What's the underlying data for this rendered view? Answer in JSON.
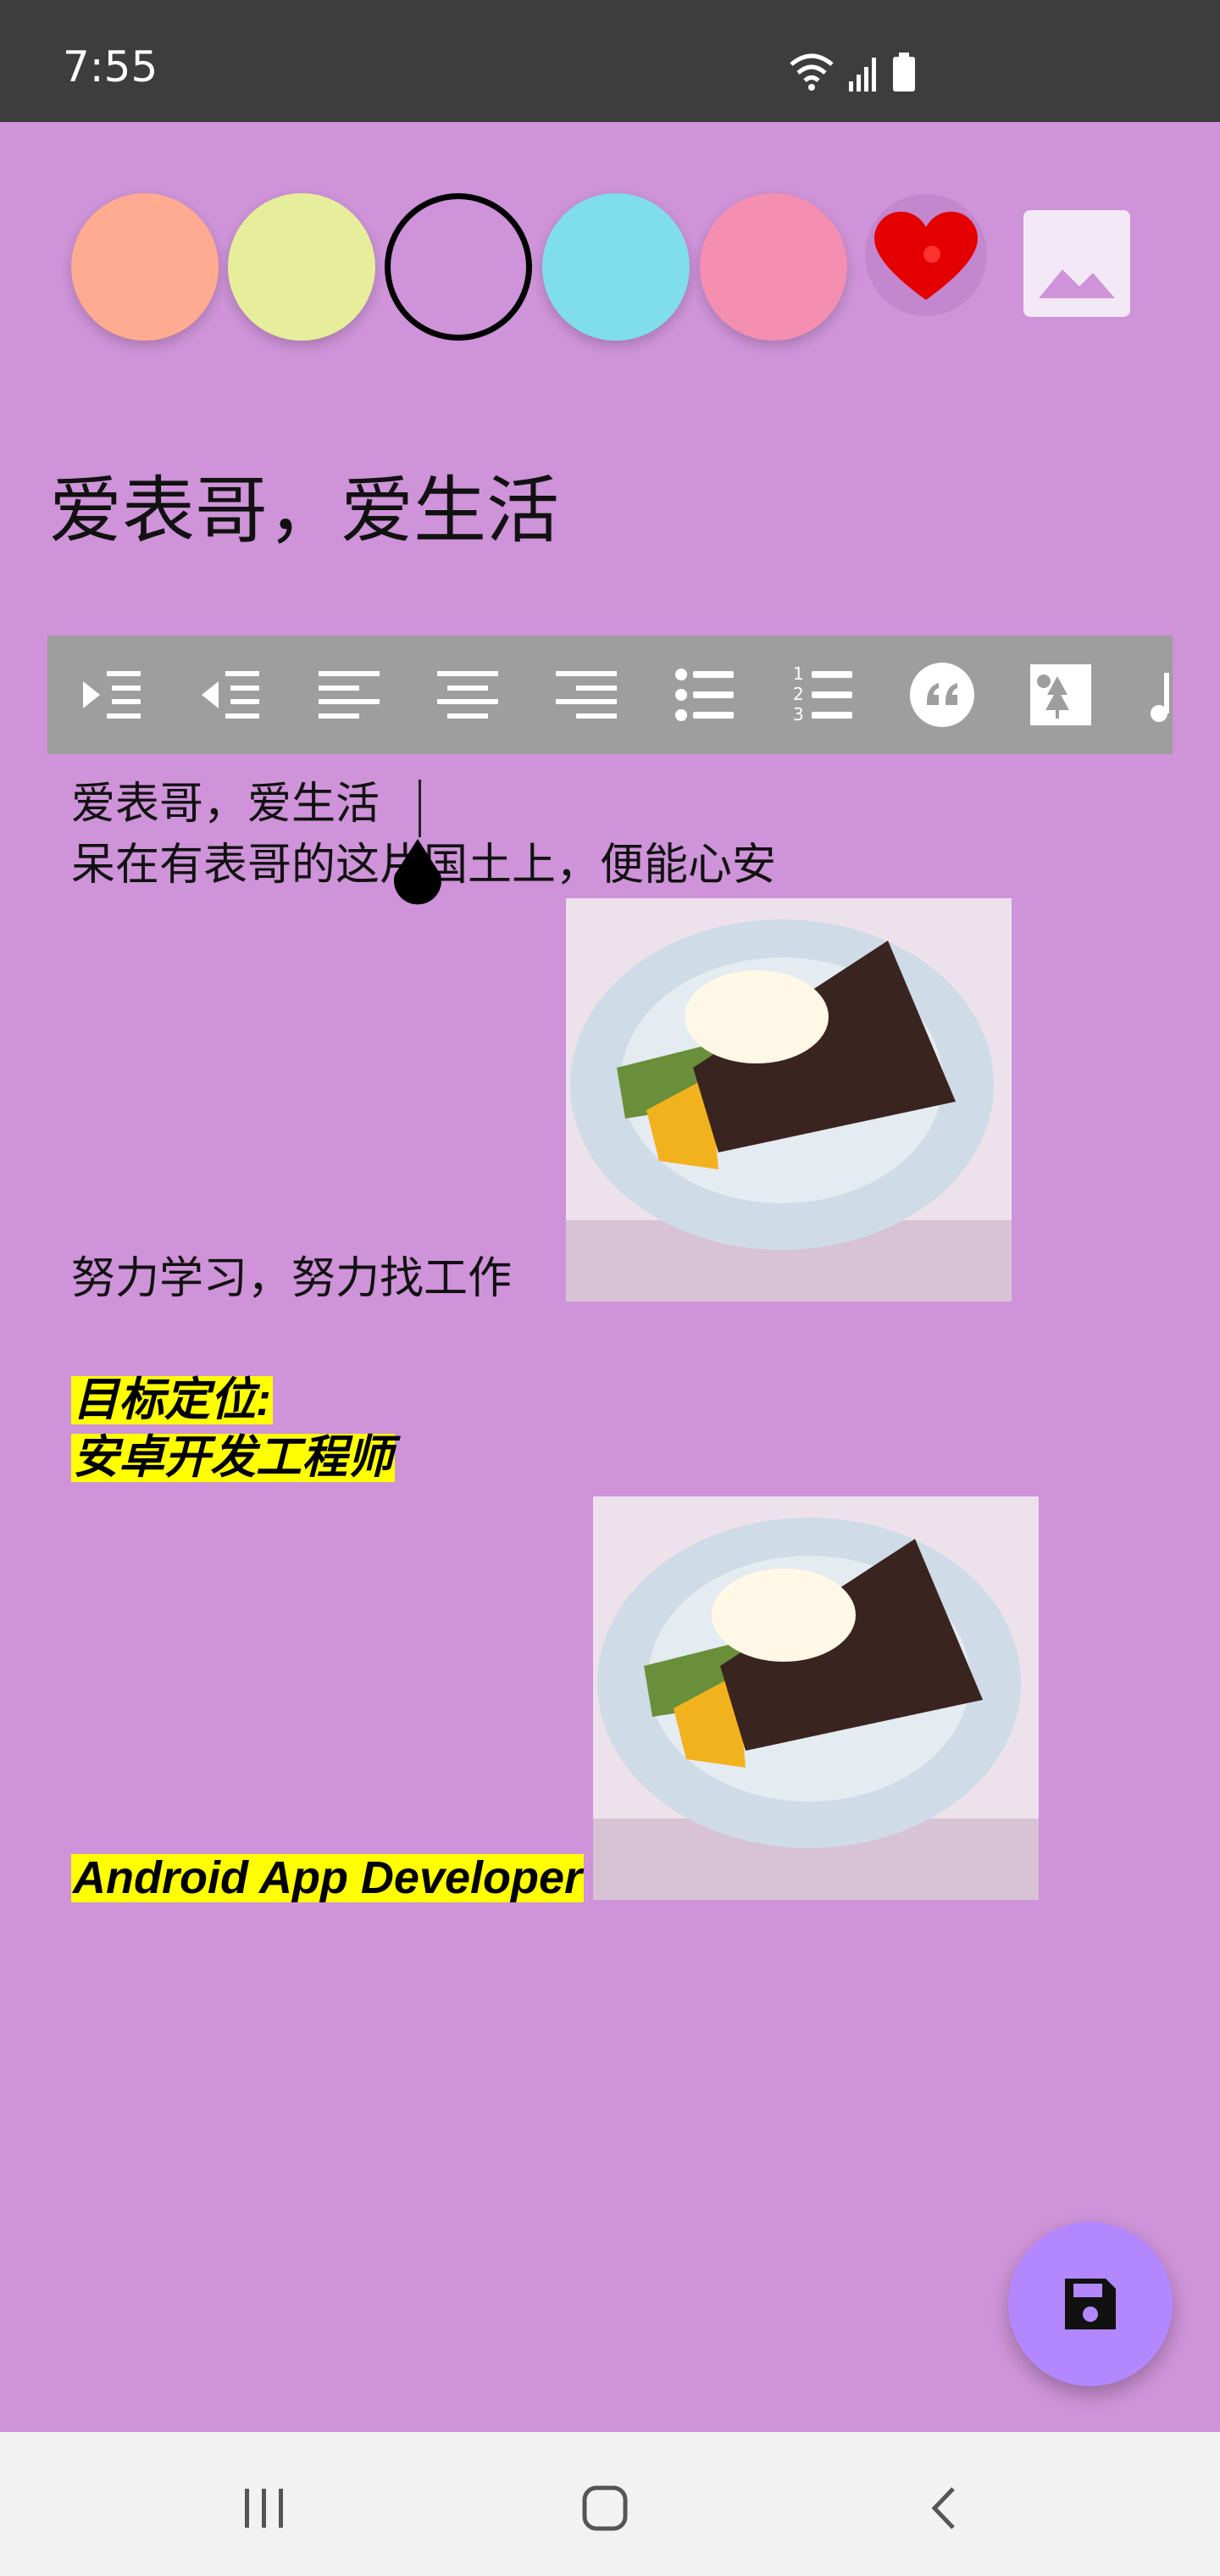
{
  "status_bar": {
    "time": "7:55",
    "icons": [
      "wifi-icon",
      "signal-icon",
      "battery-icon"
    ]
  },
  "color_picker": {
    "colors": [
      "#ffab91",
      "#e6ee9c",
      "#ce93d8",
      "#80deea",
      "#f48fb1"
    ],
    "selected_index": 2,
    "favorite_icon": "heart-icon",
    "image_icon": "image-icon"
  },
  "note": {
    "title": "爱表哥，爱生活"
  },
  "toolbar": {
    "tools": [
      "indent-icon",
      "outdent-icon",
      "align-left-icon",
      "align-center-icon",
      "align-right-icon",
      "bullet-list-icon",
      "numbered-list-icon",
      "quote-icon",
      "insert-image-icon",
      "music-icon"
    ]
  },
  "editor": {
    "line1": "爱表哥，爱生活",
    "line2": "呆在有表哥的这片国土上，便能心安",
    "line3": "努力学习，努力找工作",
    "highlight1": "目标定位:",
    "highlight2": "安卓开发工程师",
    "highlight3": "Android App Developer"
  },
  "fab": {
    "icon": "save-icon"
  },
  "nav_bar": {
    "icons": [
      "recents-icon",
      "home-icon",
      "back-icon"
    ]
  },
  "colors": {
    "background": "#ce93d8",
    "toolbar": "#9e9e9e",
    "highlight": "#ffff00",
    "fab": "#b388ff",
    "heart": "#e50000"
  }
}
